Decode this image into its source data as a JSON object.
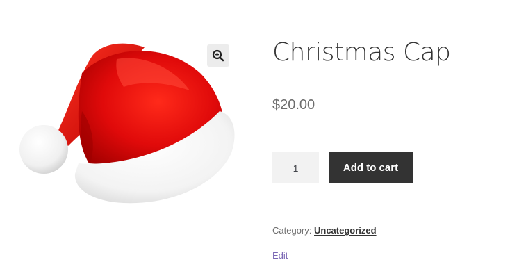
{
  "gallery": {
    "image_alt": "Christmas Cap",
    "zoom_icon": "magnify-plus-icon"
  },
  "product": {
    "title": "Christmas Cap",
    "price": "$20.00",
    "quantity": "1",
    "add_to_cart_label": "Add to cart",
    "category_label": "Category:",
    "category_value": "Uncategorized",
    "edit_label": "Edit"
  },
  "colors": {
    "button_bg": "#333333",
    "hat_red": "#e10a0a",
    "link_purple": "#7b68b5"
  }
}
